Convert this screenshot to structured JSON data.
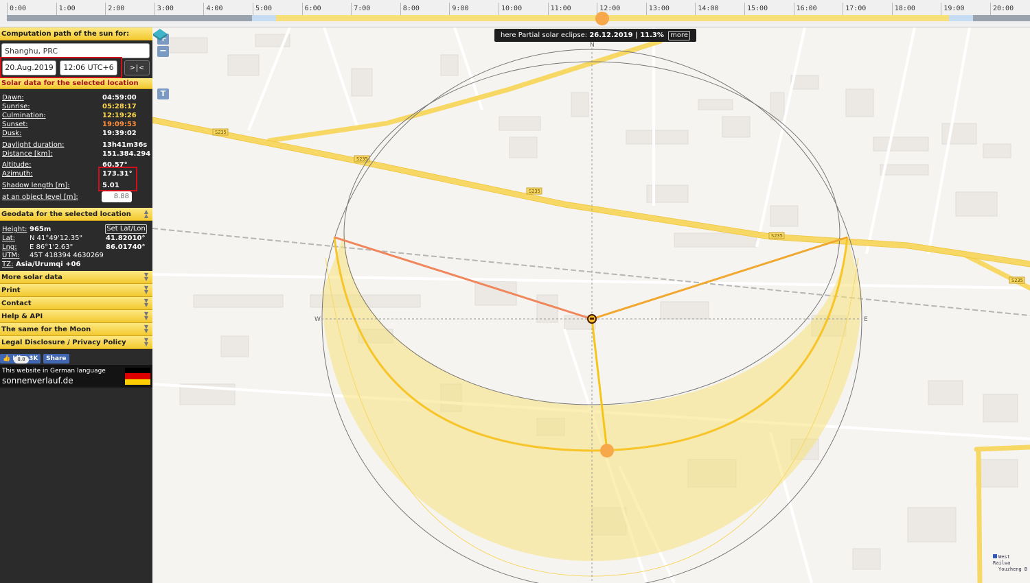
{
  "timeline": {
    "hours": [
      "0:00",
      "1:00",
      "2:00",
      "3:00",
      "4:00",
      "5:00",
      "6:00",
      "7:00",
      "8:00",
      "9:00",
      "10:00",
      "11:00",
      "12:00",
      "13:00",
      "14:00",
      "15:00",
      "16:00",
      "17:00",
      "18:00",
      "19:00",
      "20:00"
    ],
    "knob_time": "12:06"
  },
  "sidebar": {
    "header": "Computation path of the sun for:",
    "location": "Shanghu, PRC",
    "date": "20.Aug.2019",
    "time": "12:06 UTC+6",
    "nav_button": ">|<",
    "solar_header": "Solar data for the selected location",
    "solar": {
      "dawn_label": "Dawn:",
      "dawn": "04:59:00",
      "sunrise_label": "Sunrise:",
      "sunrise": "05:28:17",
      "culmination_label": "Culmination:",
      "culmination": "12:19:26",
      "sunset_label": "Sunset:",
      "sunset": "19:09:53",
      "dusk_label": "Dusk:",
      "dusk": "19:39:02",
      "daylight_label": "Daylight duration:",
      "daylight": "13h41m36s",
      "distance_label": "Distance [km]:",
      "distance": "151.384.294",
      "altitude_label": "Altitude:",
      "altitude": "60.57°",
      "azimuth_label": "Azimuth:",
      "azimuth": "173.31°",
      "shadow_label": "Shadow length [m]:",
      "shadow": "5.01",
      "object_label": "at an object level [m]:",
      "object_level": "8.88"
    },
    "geo_header": "Geodata for the selected location",
    "geo": {
      "height_label": "Height:",
      "height": "965m",
      "set_latlon": "Set Lat/Lon",
      "lat_label": "Lat:",
      "lat_dms": "N 41°49'12.35\"",
      "lat_dec": "41.82010°",
      "lng_label": "Lng:",
      "lng_dms": "E 86°1'2.63\"",
      "lng_dec": "86.01740°",
      "utm_label": "UTM:",
      "utm": "45T 418394 4630269",
      "tz_label": "TZ:",
      "tz": "Asia/Urumqi  +06"
    },
    "menu": [
      "More solar data",
      "Print",
      "Contact",
      "Help & API",
      "The same for the Moon",
      "Legal Disclosure / Privacy Policy"
    ],
    "social": {
      "like": "Like 3K",
      "share": "Share",
      "badge": "8.8"
    },
    "german": {
      "text": "This website in German language",
      "site": "sonnenverlauf.de"
    }
  },
  "map": {
    "eclipse_prefix": "here Partial solar eclipse:",
    "eclipse_date": "26.12.2019 | 11.3%",
    "more": "more",
    "zoom_in": "+",
    "zoom_out": "−",
    "terrain": "T",
    "compass": {
      "n": "N",
      "w": "W",
      "e": "E"
    },
    "road_labels": [
      "S235",
      "S235",
      "S235",
      "S235",
      "S235"
    ],
    "attribution": [
      "West Railwa",
      "Youzheng B"
    ],
    "colors": {
      "sunrise_line": "#f0875c",
      "sunset_line": "#f0a830",
      "sun_line": "#f5c518",
      "sun_marker": "#f7a84a",
      "path_fill": "#f7e27a"
    }
  }
}
